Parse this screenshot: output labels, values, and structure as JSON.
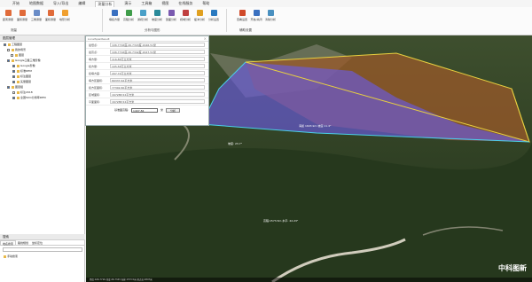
{
  "menu": [
    "开始",
    "地图数据",
    "导入/导出",
    "编辑",
    "测量分析",
    "演示",
    "工具箱",
    "视图",
    "在线服务",
    "帮助"
  ],
  "ribbon": {
    "buttons": [
      {
        "label": "距离测量",
        "color": "#e06b3a"
      },
      {
        "label": "面积测量",
        "color": "#e06b3a"
      },
      {
        "label": "三角测量",
        "color": "#6a8cc7"
      },
      {
        "label": "面积测量",
        "color": "#e06b3a"
      },
      {
        "label": "地形分析",
        "color": "#f0a030"
      },
      {
        "label": "填挖方量",
        "color": "#3a70c0"
      },
      {
        "label": "高程分析",
        "color": "#3f9c4a"
      },
      {
        "label": "通视分析",
        "color": "#4aa0c8"
      },
      {
        "label": "坡度分析",
        "color": "#2a8a9a"
      },
      {
        "label": "剖面分析",
        "color": "#7a5ab0"
      },
      {
        "label": "视域分析",
        "color": "#c04040"
      },
      {
        "label": "缓冲分析",
        "color": "#e0a020"
      },
      {
        "label": "分析设置",
        "color": "#2a7ac0"
      },
      {
        "label": "查看设置",
        "color": "#d04a2a"
      },
      {
        "label": "开启/关闭",
        "color": "#3a70c0"
      },
      {
        "label": "清除分析",
        "color": "#4a90c0"
      }
    ],
    "groups": [
      "测量",
      "分析与图形",
      "辅助设置"
    ]
  },
  "left": {
    "panel_title": "图层管理",
    "tree": [
      "工程图层",
      "我的场景",
      "图层",
      "Google卫星三维影像",
      "Google影像",
      "标准DEM",
      "标注图层",
      "矢量图层",
      "图层组",
      "标注2018",
      "全国50m分辨率DEM"
    ],
    "bottom_title": "搜索",
    "tabs": [
      "地名搜索",
      "路线规划",
      "坐标定位"
    ],
    "result_item": "手动搜索"
  },
  "popup": {
    "title": "LocalSpanResult",
    "rows": [
      {
        "label": "最低点:",
        "value": "106.7716度,26.7343度,1646.51米"
      },
      {
        "label": "最高点:",
        "value": "106.7716度,26.7342度,1647.51米"
      },
      {
        "label": "填方量:",
        "value": "116.86万立方米"
      },
      {
        "label": "挖方量:",
        "value": "105.58万立方米"
      },
      {
        "label": "挖填方差:",
        "value": "207.74万立方米"
      },
      {
        "label": "填方区面积:",
        "value": "89337.62平方米"
      },
      {
        "label": "挖方区面积:",
        "value": "77302.60平方米"
      },
      {
        "label": "区域面积:",
        "value": "167288.52平方米"
      },
      {
        "label": "平面面积:",
        "value": "167288.52平方米"
      }
    ],
    "elev_label": "基准面高程:",
    "elev_value": "1407.84",
    "unit": "米",
    "button": "分析"
  },
  "map": {
    "labels": [
      "坡度: 23.7°",
      "高程:1573.5m  水平: 22.23°",
      "海拔 1603.9m 坡度:11.4°"
    ],
    "logo": "中科图新",
    "status": "经度:106.7716 纬度:26.7343 海拔:1573.5米 视点高:2847米"
  }
}
